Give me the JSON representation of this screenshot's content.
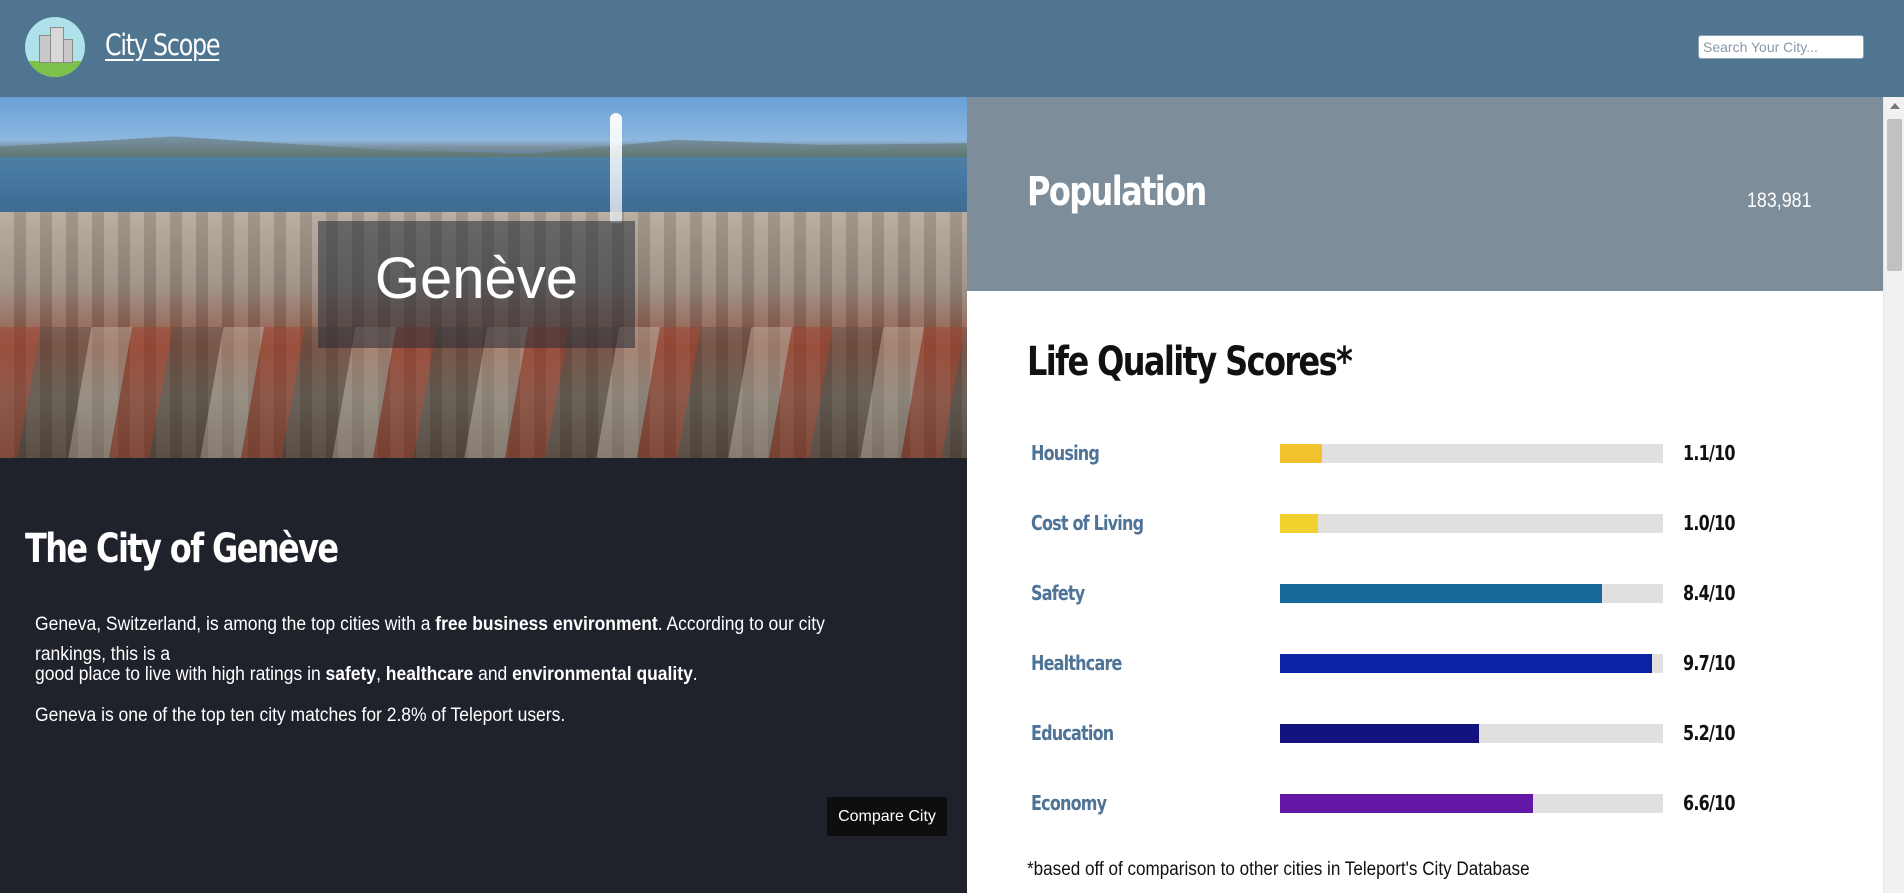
{
  "header": {
    "brand": "City Scope",
    "search_placeholder": "Search Your City..."
  },
  "hero": {
    "city_name": "Genève"
  },
  "info": {
    "title": "The City of Genève",
    "para1_a": "Geneva, Switzerland, is among the top cities with a ",
    "para1_b": "free business environment",
    "para1_c": ". According to our city rankings, this is a",
    "para2_a": "good place to live with high ratings in ",
    "para2_b": "safety",
    "para2_c": ", ",
    "para2_d": "healthcare",
    "para2_e": " and ",
    "para2_f": "environmental quality",
    "para2_g": ".",
    "para3": "Geneva is one of the top ten city matches for 2.8% of Teleport users.",
    "compare_button": "Compare City"
  },
  "population": {
    "label": "Population",
    "value": "183,981"
  },
  "scores": {
    "title": "Life Quality Scores*",
    "items": [
      {
        "label": "Housing",
        "score": "1.1/10",
        "value": 1.1,
        "color": "#f2c12e"
      },
      {
        "label": "Cost of Living",
        "score": "1.0/10",
        "value": 1.0,
        "color": "#f2d02e"
      },
      {
        "label": "Safety",
        "score": "8.4/10",
        "value": 8.4,
        "color": "#16689a"
      },
      {
        "label": "Healthcare",
        "score": "9.7/10",
        "value": 9.7,
        "color": "#0a22a3"
      },
      {
        "label": "Education",
        "score": "5.2/10",
        "value": 5.2,
        "color": "#14127e"
      },
      {
        "label": "Economy",
        "score": "6.6/10",
        "value": 6.6,
        "color": "#6418a6"
      }
    ],
    "footnote": "*based off of comparison to other cities in Teleport's City Database"
  }
}
